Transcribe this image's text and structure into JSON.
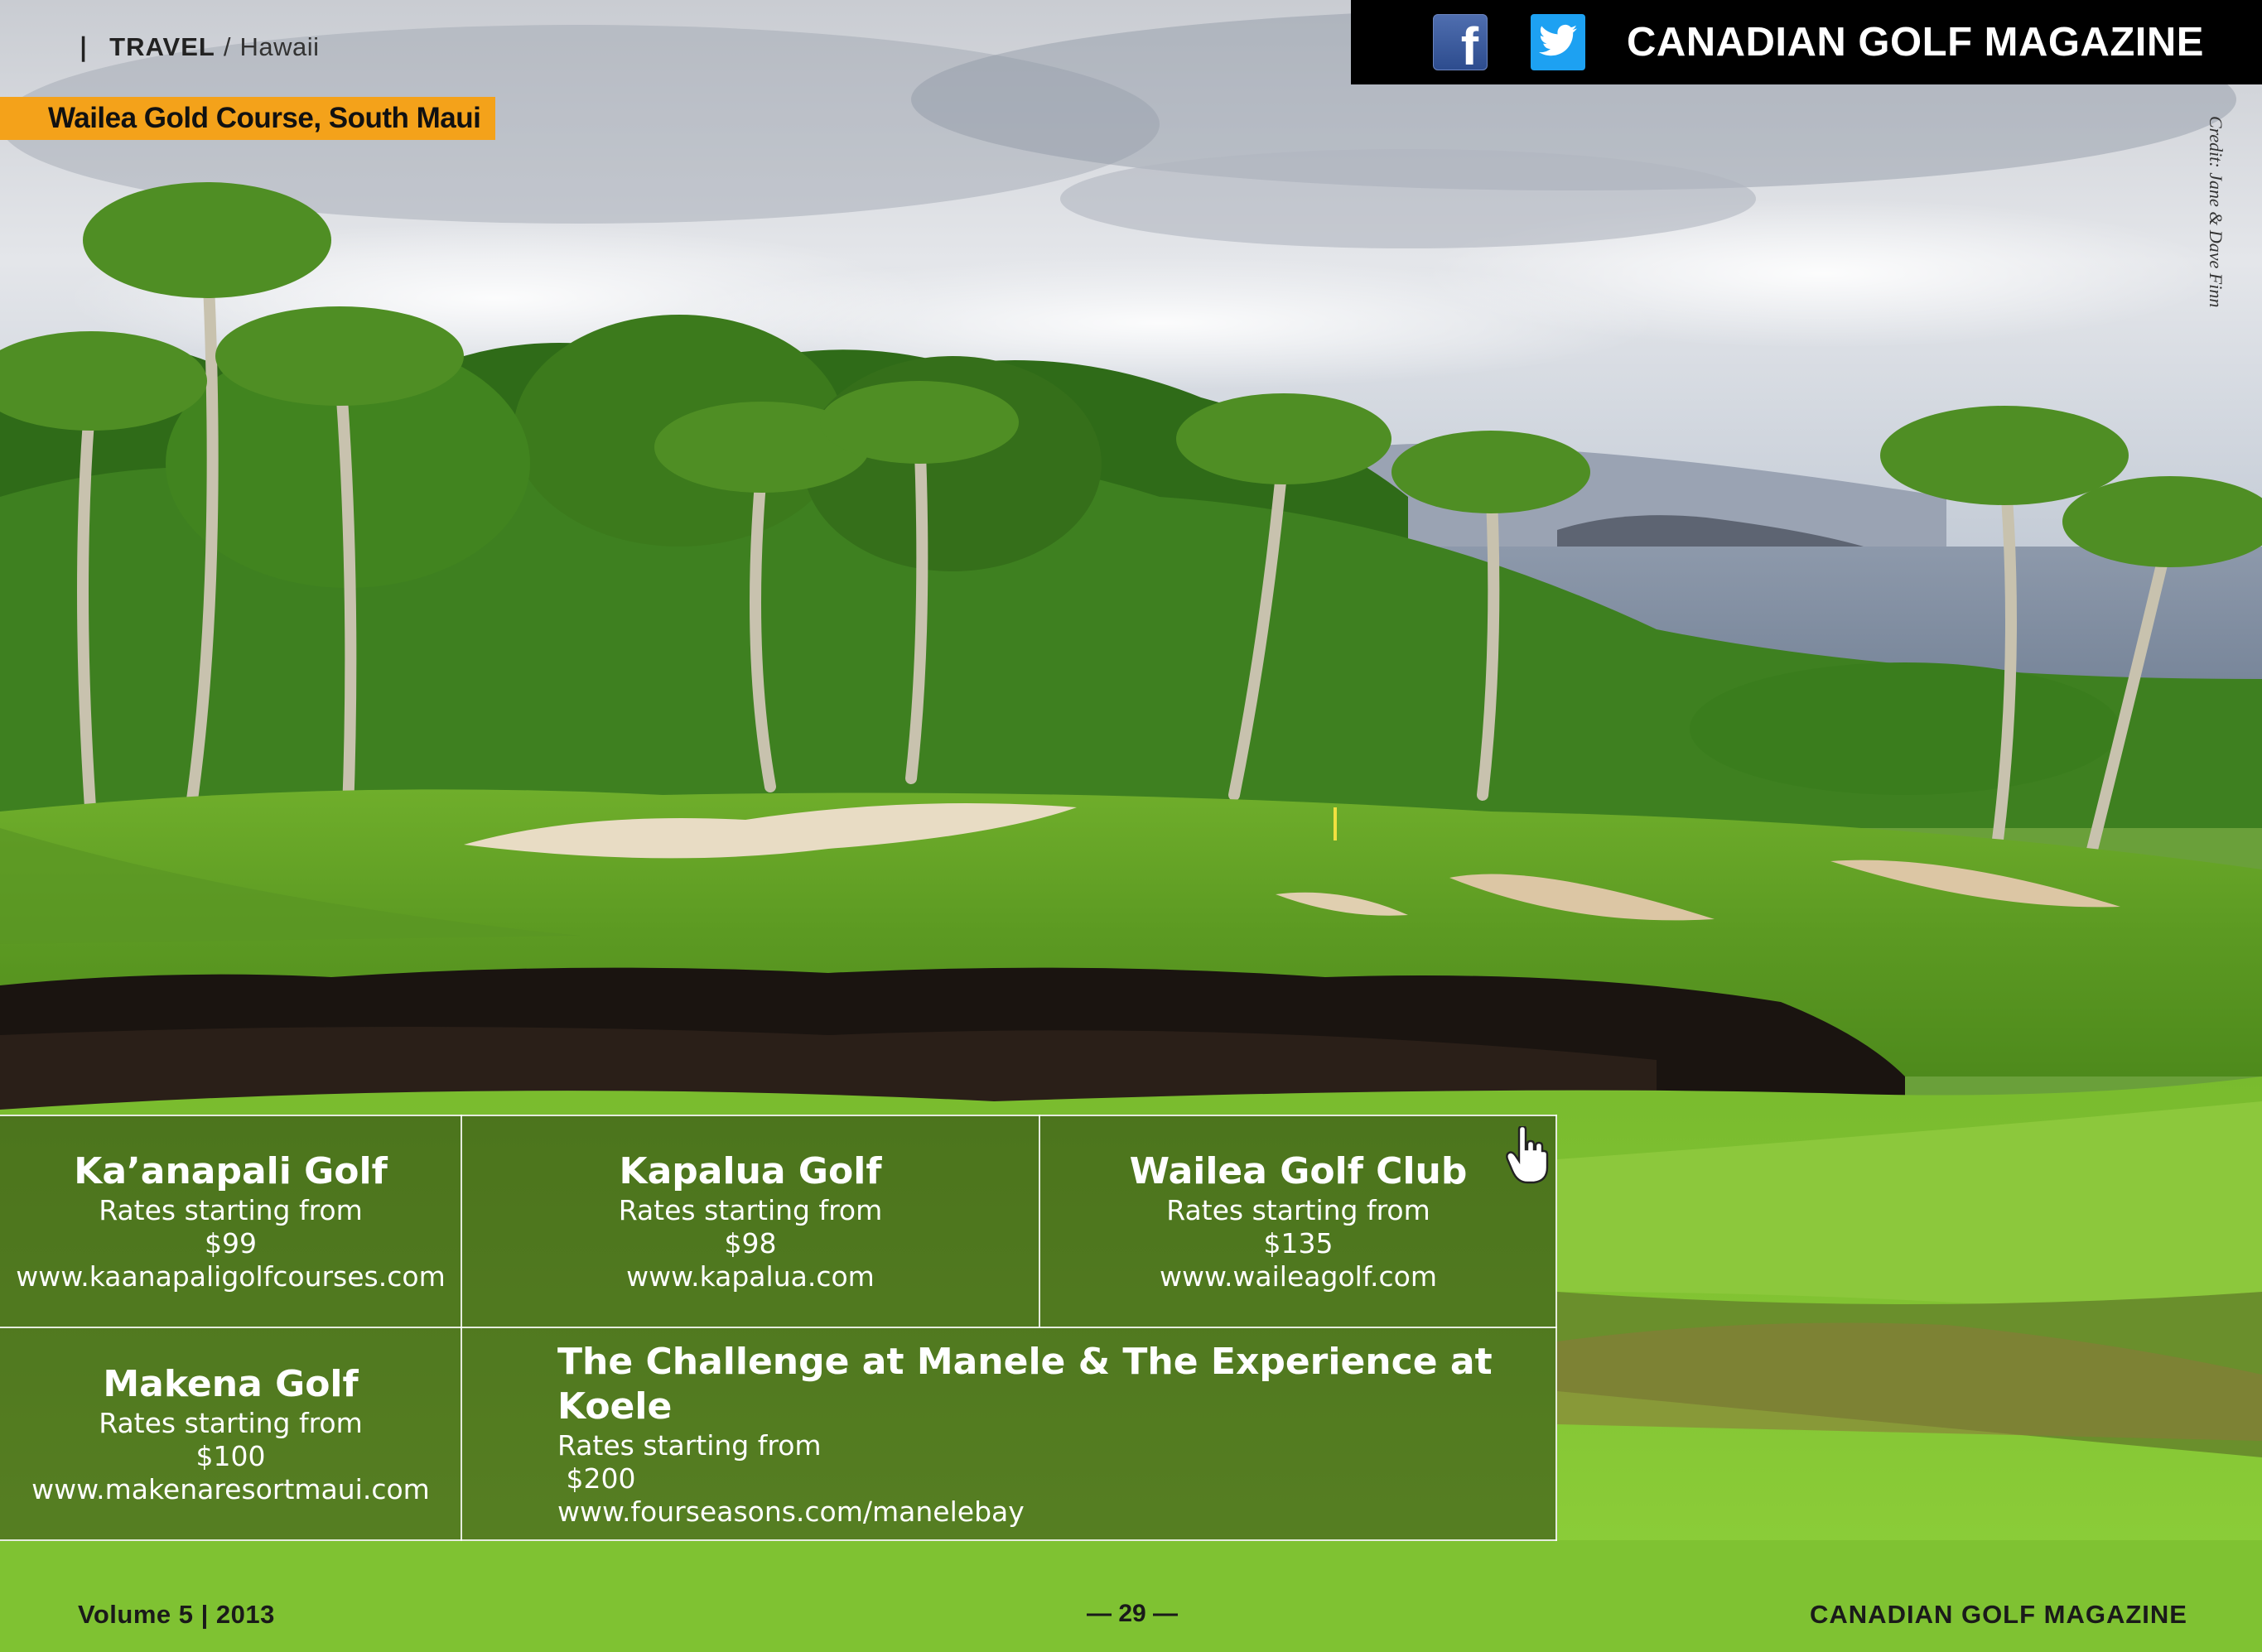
{
  "section": {
    "pin_glyph": "❘",
    "category": "TRAVEL",
    "separator": "/",
    "subcategory": "Hawaii"
  },
  "caption": "Wailea Gold Course, South Maui",
  "masthead": {
    "title": "CANADIAN GOLF MAGAZINE",
    "facebook_label": "f",
    "facebook_icon": "facebook-icon",
    "twitter_icon": "twitter-icon",
    "bg_color": "#000000"
  },
  "photo_credit": "Credit: Jane & Dave Finn",
  "courses": [
    {
      "name": "Ka’anapali Golf",
      "rates_label": "Rates starting from",
      "price": "$99",
      "url": "www.kaanapaligolfcourses.com"
    },
    {
      "name": "Kapalua Golf",
      "rates_label": "Rates starting from",
      "price": "$98",
      "url": "www.kapalua.com"
    },
    {
      "name": "Wailea Golf Club",
      "rates_label": "Rates starting from",
      "price": "$135",
      "url": "www.waileagolf.com"
    },
    {
      "name": "Makena Golf",
      "rates_label": "Rates starting from",
      "price": "$100",
      "url": "www.makenaresortmaui.com"
    },
    {
      "name": "The Challenge at Manele & The Experience at Koele",
      "rates_label": "Rates starting from",
      "price": " $200",
      "url": "www.fourseasons.com/manelebay"
    }
  ],
  "footer": {
    "volume": "Volume 5 | 2013",
    "page": "— 29 —",
    "publication": "CANADIAN GOLF MAGAZINE"
  },
  "colors": {
    "accent": "#f4a21a",
    "twitter": "#1da1f2",
    "facebook": "#3b5998"
  }
}
